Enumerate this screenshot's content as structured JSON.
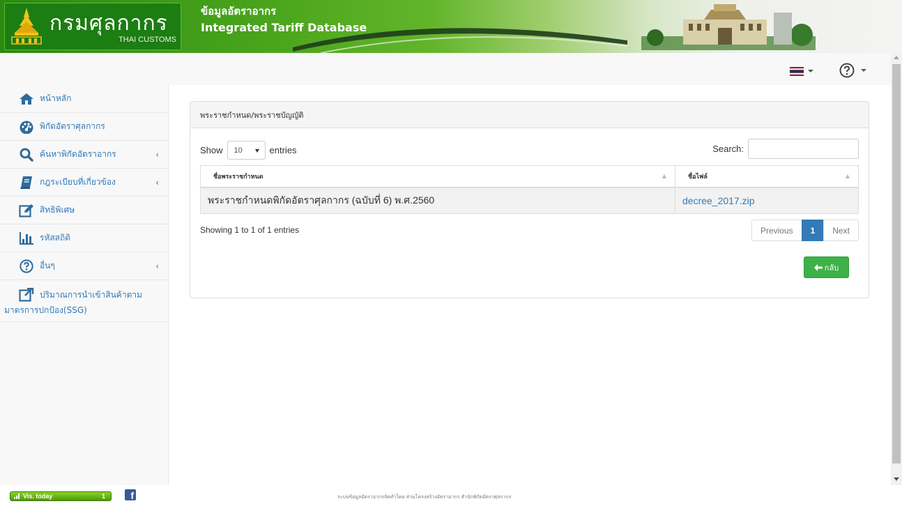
{
  "header": {
    "logo_text": "กรมศุลกากร",
    "logo_sub": "THAI CUSTOMS",
    "title_th": "ข้อมูลอัตราอากร",
    "title_en": "Integrated Tariff Database"
  },
  "topbar": {
    "language_icon": "thai-flag-icon",
    "help_icon": "question-circle-icon"
  },
  "sidebar": {
    "items": [
      {
        "label": "หน้าหลัก",
        "icon": "home-icon",
        "has_submenu": false
      },
      {
        "label": "พิกัดอัตราศุลกากร",
        "icon": "dashboard-icon",
        "has_submenu": false
      },
      {
        "label": "ค้นหาพิกัดอัตราอากร",
        "icon": "search-icon",
        "has_submenu": true
      },
      {
        "label": "กฎระเบียบที่เกี่ยวข้อง",
        "icon": "book-icon",
        "has_submenu": true
      },
      {
        "label": "สิทธิพิเศษ",
        "icon": "edit-icon",
        "has_submenu": false
      },
      {
        "label": "รหัสสถิติ",
        "icon": "bar-chart-icon",
        "has_submenu": false
      },
      {
        "label": "อื่นๆ",
        "icon": "question-circle-icon",
        "has_submenu": true
      },
      {
        "label": "ปริมาณการนำเข้าสินค้าตาม",
        "label_line2": "มาตรการปกป้อง(SSG)",
        "icon": "external-link-icon",
        "has_submenu": false
      }
    ],
    "chevron": "‹"
  },
  "panel": {
    "heading": "พระราชกำหนด/พระราชบัญญัติ",
    "show_label": "Show",
    "entries_label": "entries",
    "page_length": "10",
    "search_label": "Search:",
    "search_value": "",
    "columns": [
      "ชื่อพระราชกำหนด",
      "ชื่อไฟล์"
    ],
    "rows": [
      {
        "name": "พระราชกำหนดพิกัดอัตราศุลกากร (ฉบับที่ 6) พ.ศ.2560",
        "file": "decree_2017.zip"
      }
    ],
    "info": "Showing 1 to 1 of 1 entries",
    "pagination": {
      "previous": "Previous",
      "current": "1",
      "next": "Next"
    },
    "back_label": "กลับ"
  },
  "footer": {
    "visitor_label": "Vis. today",
    "visitor_count": "1",
    "credit": "ระบบข้อมูลอัตราอากรจัดทำโดย ส่วนโครงสร้างอัตราอากร สำนักพิกัดอัตราศุลกากร"
  },
  "colors": {
    "brand_green": "#2c8a12",
    "link_blue": "#337ab7",
    "success_green": "#3cb247"
  }
}
